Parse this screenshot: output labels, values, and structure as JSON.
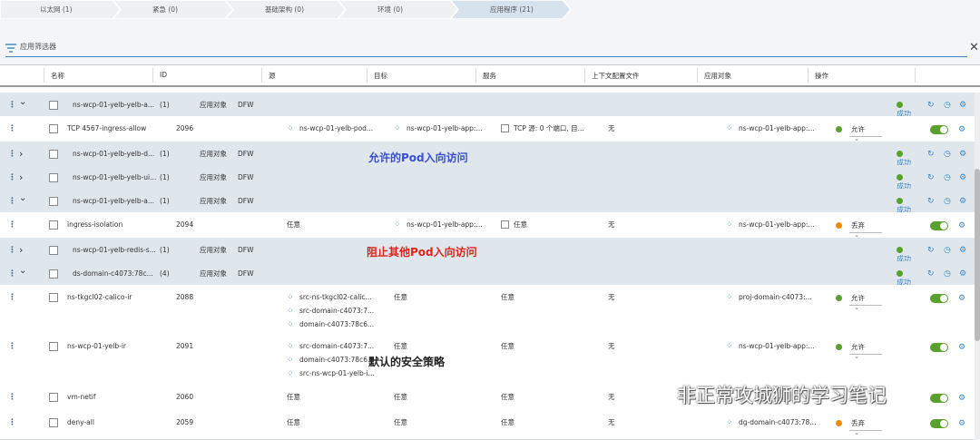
{
  "breadcrumbs": [
    {
      "label": "以太网 (1)"
    },
    {
      "label": "紧急 (0)"
    },
    {
      "label": "基础架构 (0)"
    },
    {
      "label": "环境 (0)"
    },
    {
      "label": "应用程序 (21)"
    }
  ],
  "filter": {
    "placeholder": "应用筛选器"
  },
  "columns": [
    "名称",
    "ID",
    "源",
    "目标",
    "服务",
    "上下文配置文件",
    "应用对象",
    "操作"
  ],
  "rows": [
    {
      "type": "section",
      "expanded": true,
      "name": "ns-wcp-01-yelb-yelb-a...",
      "count": "(1)",
      "applied": "应用对象",
      "dfw": "DFW",
      "status": "成功"
    },
    {
      "type": "rule",
      "name": "TCP 4567-ingress-allow",
      "id": "2096",
      "source": [
        "ns-wcp-01-yelb-pod..."
      ],
      "dest": [
        "ns-wcp-01-yelb-app:..."
      ],
      "service": "TCP 源: 0 个端口, 目...",
      "profile": "无",
      "applied": "ns-wcp-01-yelb-app:...",
      "action": "允许",
      "action_color": "#5aa02c"
    },
    {
      "type": "section",
      "expanded": false,
      "name": "ns-wcp-01-yelb-yelb-d...",
      "count": "(1)",
      "applied": "应用对象",
      "dfw": "DFW",
      "status": "成功"
    },
    {
      "type": "section",
      "expanded": false,
      "name": "ns-wcp-01-yelb-yelb-ui...",
      "count": "(1)",
      "applied": "应用对象",
      "dfw": "DFW",
      "status": "成功"
    },
    {
      "type": "section",
      "expanded": true,
      "name": "ns-wcp-01-yelb-yelb-a...",
      "count": "(1)",
      "applied": "应用对象",
      "dfw": "DFW",
      "status": "成功"
    },
    {
      "type": "rule",
      "name": "ingress-isolation",
      "id": "2094",
      "source": [
        "任意"
      ],
      "source_plain": true,
      "dest": [
        "ns-wcp-01-yelb-app:..."
      ],
      "service": "任意",
      "profile": "无",
      "applied": "ns-wcp-01-yelb-app:...",
      "action": "丢弃",
      "action_color": "#f08a00"
    },
    {
      "type": "section",
      "expanded": false,
      "name": "ns-wcp-01-yelb-redis-s...",
      "count": "(1)",
      "applied": "应用对象",
      "dfw": "DFW",
      "status": "成功"
    },
    {
      "type": "section",
      "expanded": true,
      "name": "ds-domain-c4073:78c...",
      "count": "(4)",
      "applied": "应用对象",
      "dfw": "DFW",
      "status": "成功"
    },
    {
      "type": "rule",
      "name": "ns-tkgcl02-calico-ir",
      "id": "2088",
      "source": [
        "src-ns-tkgcl02-calic...",
        "src-domain-c4073:7...",
        "domain-c4073:78c6..."
      ],
      "dest": [
        "任意"
      ],
      "dest_plain": true,
      "service": "任意",
      "profile": "无",
      "applied": "proj-domain-c4073:...",
      "action": "允许",
      "action_color": "#5aa02c"
    },
    {
      "type": "rule",
      "name": "ns-wcp-01-yelb-ir",
      "id": "2091",
      "source": [
        "src-domain-c4073:7...",
        "domain-c4073:78c6...",
        "src-ns-wcp-01-yelb-i..."
      ],
      "dest": [
        "任意"
      ],
      "dest_plain": true,
      "service": "任意",
      "profile": "无",
      "applied": "ns-wcp-01-yelb-app:...",
      "action": "允许",
      "action_color": "#5aa02c"
    },
    {
      "type": "rule",
      "name": "vm-netif",
      "id": "2060",
      "source": [
        "任意"
      ],
      "source_plain": true,
      "dest": [
        "任意"
      ],
      "dest_plain": true,
      "service": "任意",
      "profile": "无",
      "applied": "",
      "action": "",
      "action_color": "#5aa02c"
    },
    {
      "type": "rule",
      "name": "deny-all",
      "id": "2059",
      "source": [
        "任意"
      ],
      "source_plain": true,
      "dest": [
        "任意"
      ],
      "dest_plain": true,
      "service": "任意",
      "profile": "无",
      "applied": "dg-domain-c4073:78...",
      "action": "丢弃",
      "action_color": "#f08a00"
    }
  ],
  "annotations": [
    {
      "text": "允许的Pod入向访问",
      "color": "#3a4fd0"
    },
    {
      "text": "阻止其他Pod入向访问",
      "color": "#e0231a"
    },
    {
      "text": "默认的安全策略",
      "color": "#222222"
    }
  ],
  "watermark": {
    "text": "非正常攻城狮的学习笔记"
  }
}
